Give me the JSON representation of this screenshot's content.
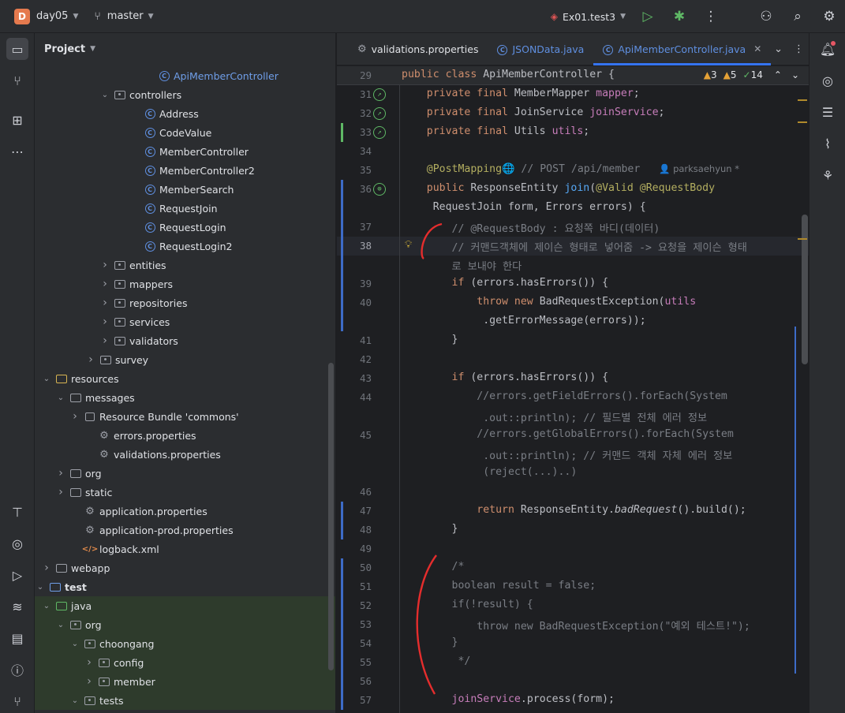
{
  "titlebar": {
    "project_initial": "D",
    "project_name": "day05",
    "branch": "master",
    "run_config": "Ex01.test3"
  },
  "project_panel": {
    "title": "Project",
    "tree": [
      {
        "label": "ApiMemberController",
        "kind": "class",
        "indent": 200,
        "arrow": ""
      },
      {
        "label": "controllers",
        "kind": "pkg",
        "indent": 144,
        "arrow": "down"
      },
      {
        "label": "Address",
        "kind": "class",
        "indent": 182,
        "arrow": ""
      },
      {
        "label": "CodeValue",
        "kind": "class",
        "indent": 182,
        "arrow": ""
      },
      {
        "label": "MemberController",
        "kind": "class",
        "indent": 182,
        "arrow": ""
      },
      {
        "label": "MemberController2",
        "kind": "class",
        "indent": 182,
        "arrow": ""
      },
      {
        "label": "MemberSearch",
        "kind": "class",
        "indent": 182,
        "arrow": ""
      },
      {
        "label": "RequestJoin",
        "kind": "class",
        "indent": 182,
        "arrow": ""
      },
      {
        "label": "RequestLogin",
        "kind": "class",
        "indent": 182,
        "arrow": ""
      },
      {
        "label": "RequestLogin2",
        "kind": "class",
        "indent": 182,
        "arrow": ""
      },
      {
        "label": "entities",
        "kind": "pkg",
        "indent": 144,
        "arrow": "right"
      },
      {
        "label": "mappers",
        "kind": "pkg",
        "indent": 144,
        "arrow": "right"
      },
      {
        "label": "repositories",
        "kind": "pkg",
        "indent": 144,
        "arrow": "right"
      },
      {
        "label": "services",
        "kind": "pkg",
        "indent": 144,
        "arrow": "right"
      },
      {
        "label": "validators",
        "kind": "pkg",
        "indent": 144,
        "arrow": "right"
      },
      {
        "label": "survey",
        "kind": "pkg",
        "indent": 126,
        "arrow": "right"
      },
      {
        "label": "resources",
        "kind": "res",
        "indent": 70,
        "arrow": "down"
      },
      {
        "label": "messages",
        "kind": "folder",
        "indent": 88,
        "arrow": "down"
      },
      {
        "label": "Resource Bundle 'commons'",
        "kind": "bundle",
        "indent": 106,
        "arrow": "right"
      },
      {
        "label": "errors.properties",
        "kind": "props",
        "indent": 124,
        "arrow": ""
      },
      {
        "label": "validations.properties",
        "kind": "props",
        "indent": 124,
        "arrow": ""
      },
      {
        "label": "org",
        "kind": "folder",
        "indent": 88,
        "arrow": "right"
      },
      {
        "label": "static",
        "kind": "folder",
        "indent": 88,
        "arrow": "right"
      },
      {
        "label": "application.properties",
        "kind": "props",
        "indent": 106,
        "arrow": ""
      },
      {
        "label": "application-prod.properties",
        "kind": "props",
        "indent": 106,
        "arrow": ""
      },
      {
        "label": "logback.xml",
        "kind": "xml",
        "indent": 106,
        "arrow": ""
      },
      {
        "label": "webapp",
        "kind": "folder",
        "indent": 70,
        "arrow": "right"
      },
      {
        "label": "test",
        "kind": "test",
        "indent": 50,
        "arrow": "down"
      },
      {
        "label": "java",
        "kind": "src",
        "indent": 70,
        "arrow": "down"
      },
      {
        "label": "org",
        "kind": "pkg",
        "indent": 88,
        "arrow": "down"
      },
      {
        "label": "choongang",
        "kind": "pkg",
        "indent": 106,
        "arrow": "down"
      },
      {
        "label": "config",
        "kind": "pkg",
        "indent": 124,
        "arrow": "right"
      },
      {
        "label": "member",
        "kind": "pkg",
        "indent": 124,
        "arrow": "right"
      },
      {
        "label": "tests",
        "kind": "pkg",
        "indent": 106,
        "arrow": "down"
      }
    ]
  },
  "tabs": [
    {
      "label": "validations.properties",
      "icon": "gear-icon",
      "active": false,
      "java": false
    },
    {
      "label": "JSONData.java",
      "icon": "class-icon",
      "active": false,
      "java": true
    },
    {
      "label": "ApiMemberController.java",
      "icon": "class-icon",
      "active": true,
      "java": true
    }
  ],
  "inspections": {
    "warnings": "3",
    "weak_warnings": "5",
    "ok": "14"
  },
  "sticky_line": {
    "num": "29",
    "code": "public class ApiMemberController {"
  },
  "code_lines": [
    {
      "num": "31",
      "html": "    <span class='kw'>private final</span> MemberMapper <span class='fld'>mapper</span>;",
      "gutter": "bean"
    },
    {
      "num": "32",
      "html": "    <span class='kw'>private final</span> JoinService <span class='fld'>joinService</span>;",
      "gutter": "bean"
    },
    {
      "num": "33",
      "html": "    <span class='kw'>private final</span> Utils <span class='fld'>utils</span>;",
      "gutter": "bean"
    },
    {
      "num": "34",
      "html": ""
    },
    {
      "num": "35",
      "html": "    <span class='ann'>@PostMapping</span>&#x1F310;<span class='cm'> // POST /api/member   </span><span class='cm' style='font-family:\"DejaVu Sans\",sans-serif;font-size:11.5px'>&#x1F464; parksaehyun *</span>"
    },
    {
      "num": "36",
      "html": "    <span class='kw'>public</span> ResponseEntity <span class='fn'>join</span>(<span class='ann'>@Valid</span> <span class='ann'>@RequestBody</span>",
      "gutter": "web"
    },
    {
      "num": "",
      "html": "     RequestJoin form, Errors errors) {"
    },
    {
      "num": "37",
      "html": "        <span class='cm'>// @RequestBody : 요청쪽 바디(데이터)</span>"
    },
    {
      "num": "38",
      "html": "        <span class='cm'>// 커맨드객체에 제이슨 형태로 넣어줌 -> 요청을 제이슨 형태</span>",
      "current": true
    },
    {
      "num": "",
      "html": "        <span class='cm'>로 보내야 한다</span>"
    },
    {
      "num": "39",
      "html": "        <span class='kw'>if</span> (errors.hasErrors()) {"
    },
    {
      "num": "40",
      "html": "            <span class='kw'>throw new</span> BadRequestException(<span class='fld'>utils</span>"
    },
    {
      "num": "",
      "html": "             .getErrorMessage(errors));"
    },
    {
      "num": "41",
      "html": "        }"
    },
    {
      "num": "42",
      "html": ""
    },
    {
      "num": "43",
      "html": "        <span class='kw'>if</span> (errors.hasErrors()) {"
    },
    {
      "num": "44",
      "html": "            <span class='cm'>//errors.getFieldErrors().forEach(System</span>"
    },
    {
      "num": "",
      "html": "             <span class='cm'>.out::println); // 필드별 전체 에러 정보</span>"
    },
    {
      "num": "45",
      "html": "            <span class='cm'>//errors.getGlobalErrors().forEach(System</span>"
    },
    {
      "num": "",
      "html": "             <span class='cm'>.out::println); // 커맨드 객체 자체 에러 정보</span>"
    },
    {
      "num": "",
      "html": "             <span class='cm'>(reject(...)..)</span>"
    },
    {
      "num": "46",
      "html": ""
    },
    {
      "num": "47",
      "html": "            <span class='kw'>return</span> ResponseEntity.<span class='it'>badRequest</span>().build();"
    },
    {
      "num": "48",
      "html": "        }"
    },
    {
      "num": "49",
      "html": ""
    },
    {
      "num": "50",
      "html": "        <span class='cm'>/*</span>"
    },
    {
      "num": "51",
      "html": "        <span class='cm'>boolean result = false;</span>"
    },
    {
      "num": "52",
      "html": "        <span class='cm'>if(!result) {</span>"
    },
    {
      "num": "53",
      "html": "            <span class='cm'>throw new BadRequestException(\"예외 테스트!\");</span>"
    },
    {
      "num": "54",
      "html": "        <span class='cm'>}</span>"
    },
    {
      "num": "55",
      "html": "         <span class='cm'>*/</span>"
    },
    {
      "num": "56",
      "html": ""
    },
    {
      "num": "57",
      "html": "        <span class='fld'>joinService</span>.process(form);"
    }
  ]
}
